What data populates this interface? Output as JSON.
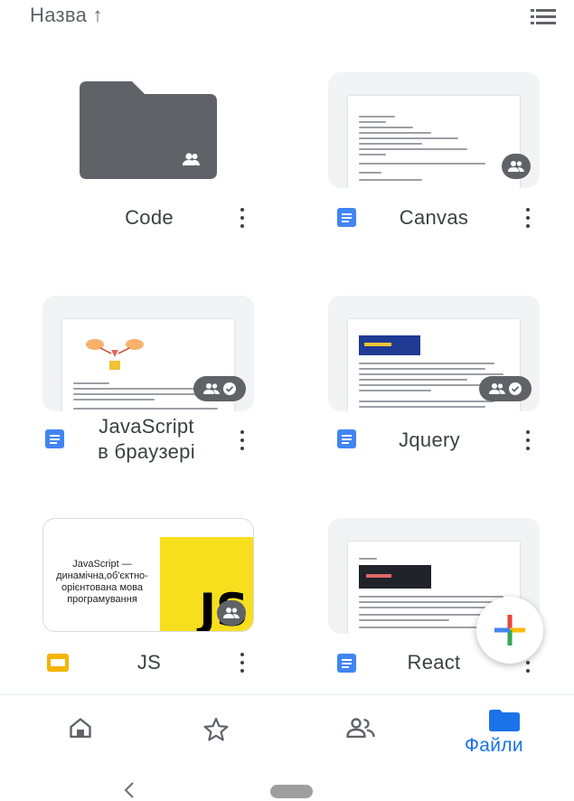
{
  "header": {
    "sort_label": "Назва ↑",
    "list_view_icon": "list-view-icon"
  },
  "files": [
    {
      "name": "Code",
      "type": "folder",
      "icon": "shared-folder-icon"
    },
    {
      "name": "Canvas",
      "type": "document",
      "icon": "google-docs-icon"
    },
    {
      "name": "JavaScript в браузері",
      "name_lines": [
        "JavaScript",
        "в браузері"
      ],
      "type": "document",
      "icon": "google-docs-icon"
    },
    {
      "name": "Jquery",
      "type": "document",
      "icon": "google-docs-icon"
    },
    {
      "name": "JS",
      "type": "presentation",
      "icon": "google-slides-icon",
      "preview": {
        "text_lines": [
          "JavaScript —",
          "динамічна,об'єктно-",
          "орієнтована мова",
          "програмування"
        ],
        "logo_text": "JS"
      }
    },
    {
      "name": "React",
      "type": "document",
      "icon": "google-docs-icon"
    }
  ],
  "fab": {
    "icon": "plus-icon"
  },
  "bottom_nav": {
    "items": [
      {
        "id": "home",
        "icon": "home-icon",
        "label": ""
      },
      {
        "id": "starred",
        "icon": "star-icon",
        "label": ""
      },
      {
        "id": "shared",
        "icon": "shared-icon",
        "label": ""
      },
      {
        "id": "files",
        "icon": "folder-icon",
        "label": "Файли",
        "active": true
      }
    ]
  },
  "colors": {
    "accent": "#1a73e8",
    "folder": "#5f6368",
    "docs_blue": "#4285f4",
    "slides_yellow": "#f4b400",
    "js_yellow": "#f7df1e"
  }
}
